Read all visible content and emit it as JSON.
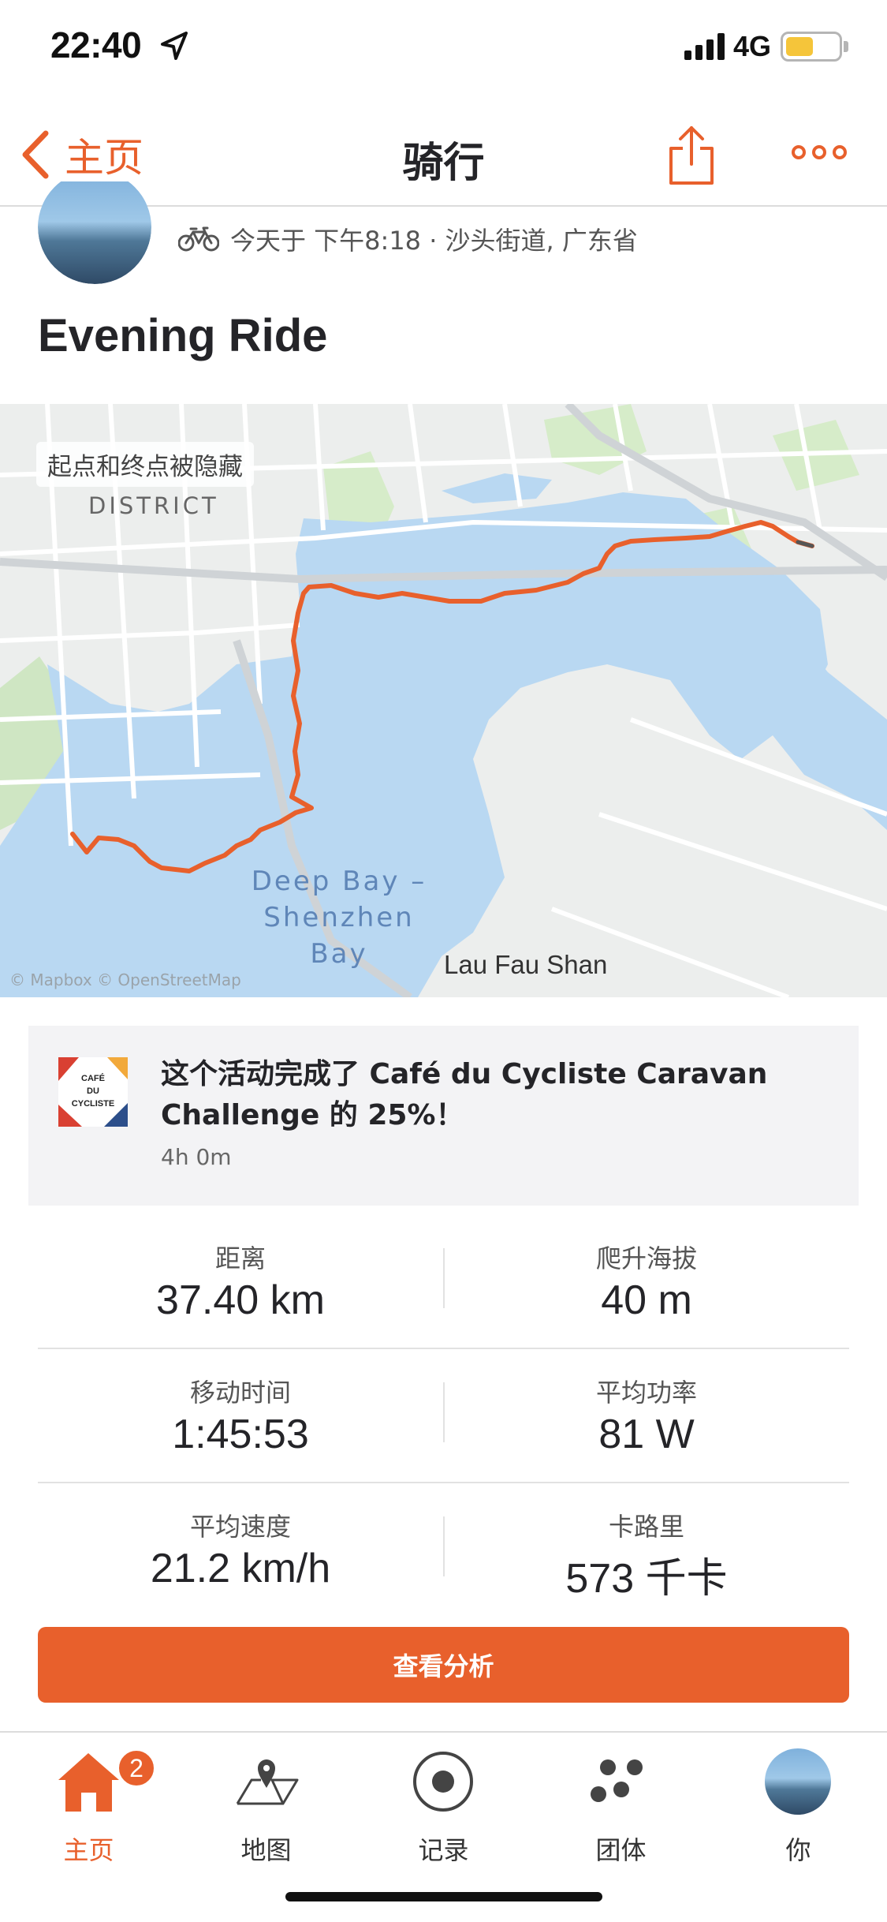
{
  "status_bar": {
    "time": "22:40",
    "network": "4G",
    "icons": [
      "location-arrow-icon",
      "signal-icon",
      "battery-icon"
    ]
  },
  "nav": {
    "back_label": "主页",
    "title": "骑行",
    "icons": [
      "chevron-left-icon",
      "share-icon",
      "more-icon"
    ]
  },
  "activity": {
    "meta": "今天于 下午8:18 · 沙头街道, 广东省",
    "title": "Evening Ride"
  },
  "map": {
    "privacy_note": "起点和终点被隐藏",
    "district_label": "DISTRICT",
    "bay_label": "Deep Bay – Shenzhen Bay",
    "place_label": "Lau Fau Shan",
    "attribution": "© Mapbox © OpenStreetMap",
    "route_color": "#e8602c"
  },
  "challenge": {
    "badge_text": "CAFÉ DU CYCLISTE",
    "text": "这个活动完成了 Café du Cycliste Caravan Challenge 的 25%！",
    "progress_percent": 25,
    "duration": "4h 0m"
  },
  "stats": [
    {
      "label": "距离",
      "value": "37.40 km"
    },
    {
      "label": "爬升海拔",
      "value": "40 m"
    },
    {
      "label": "移动时间",
      "value": "1:45:53"
    },
    {
      "label": "平均功率",
      "value": "81 W"
    },
    {
      "label": "平均速度",
      "value": "21.2 km/h"
    },
    {
      "label": "卡路里",
      "value": "573 千卡"
    }
  ],
  "cta_label": "查看分析",
  "tabs": [
    {
      "label": "主页",
      "icon": "home-icon",
      "badge": "2",
      "active": true
    },
    {
      "label": "地图",
      "icon": "map-icon"
    },
    {
      "label": "记录",
      "icon": "record-icon"
    },
    {
      "label": "团体",
      "icon": "groups-icon"
    },
    {
      "label": "你",
      "icon": "avatar"
    }
  ],
  "colors": {
    "accent": "#e8602c",
    "water": "#b9d8f2",
    "park": "#d6ecc9"
  }
}
